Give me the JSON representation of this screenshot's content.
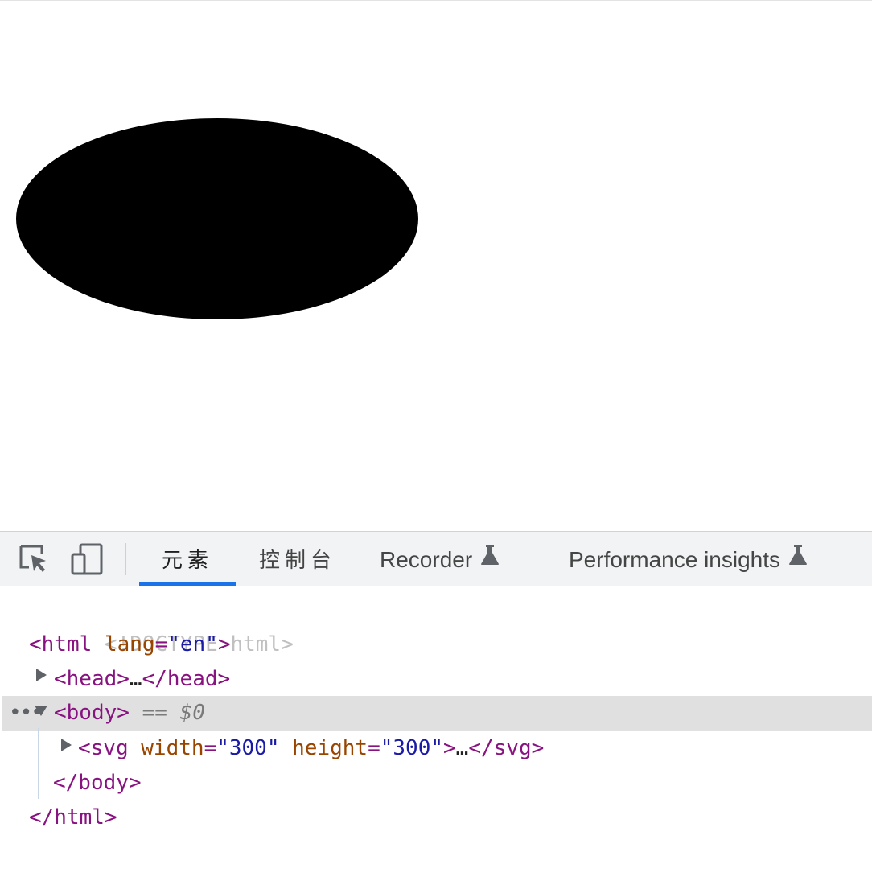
{
  "devtools": {
    "tabs": [
      {
        "label": "元素",
        "active": true
      },
      {
        "label": "控制台",
        "active": false
      },
      {
        "label": "Recorder",
        "experimental": true
      },
      {
        "label": "Performance insights",
        "experimental": true
      }
    ],
    "icons": [
      "inspect-element-icon",
      "device-toolbar-icon",
      "flask-icon"
    ],
    "accent_color": "#1a73e8"
  },
  "viewport": {
    "shape": "ellipse",
    "fill": "#000000"
  },
  "dom_tree": {
    "doctype": "<!DOCTYPE html>",
    "html_open": {
      "tag_open": "<html",
      "attr": "lang",
      "value": "en",
      "tag_close": ">"
    },
    "head": {
      "open": "<head>",
      "ellipsis": "…",
      "close": "</head>"
    },
    "body": {
      "open": "<body>",
      "marker": "== $0"
    },
    "svg": {
      "tag_open": "<svg",
      "attr1": "width",
      "value1": "300",
      "attr2": "height",
      "value2": "300",
      "tag_end": ">",
      "ellipsis": "…",
      "close": "</svg>"
    },
    "body_close": "</body>",
    "html_close": "</html>",
    "selected_dots": "•••"
  }
}
